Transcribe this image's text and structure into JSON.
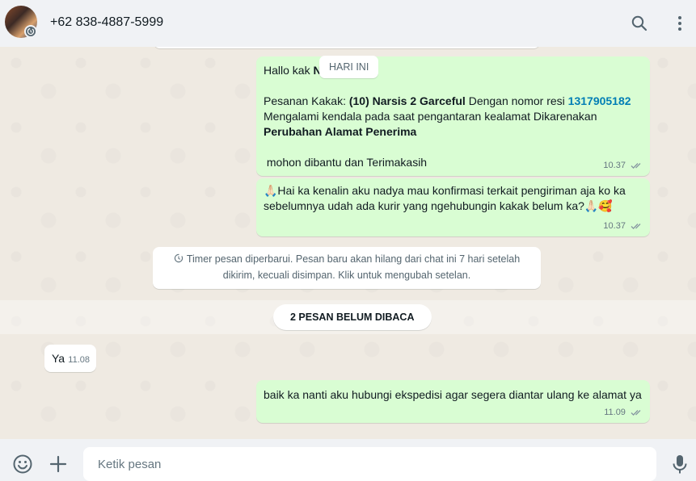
{
  "header": {
    "contact": "+62 838-4887-5999",
    "icons": [
      "search-icon",
      "menu-icon"
    ]
  },
  "day_divider": "HARI INI",
  "messages": [
    {
      "greeting_prefix": "Hallo kak ",
      "greeting_name_partial": "N",
      "order_prefix": "Pesanan Kakak: ",
      "order_product": "(10) Narsis 2 Garceful",
      "order_mid": " Dengan nomor resi ",
      "order_resi": "1317905182",
      "line_issue": "Mengalami kendala pada saat pengantaran kealamat Dikarenakan",
      "line_reason": "Perubahan Alamat Penerima",
      "line_close": " mohon dibantu dan Terimakasih",
      "time": "10.37"
    },
    {
      "text": "🙏🏻Hai ka kenalin aku nadya mau konfirmasi terkait pengiriman aja ko ka sebelumnya udah ada kurir yang ngehubungin kakak belum ka?🙏🏻🥰",
      "time": "10.37"
    }
  ],
  "system_message": "Timer pesan diperbarui. Pesan baru akan hilang dari chat ini 7 hari setelah dikirim, kecuali disimpan. Klik untuk mengubah setelan.",
  "unread_label": "2 PESAN BELUM DIBACA",
  "incoming": {
    "text": "Ya",
    "time": "11.08"
  },
  "reply": {
    "text": "baik ka nanti aku hubungi ekspedisi agar segera diantar ulang ke alamat ya",
    "time": "11.09"
  },
  "composer": {
    "placeholder": "Ketik pesan"
  },
  "colors": {
    "outgoing": "#d9fdd3",
    "link": "#027eb5",
    "header": "#f0f2f5"
  }
}
